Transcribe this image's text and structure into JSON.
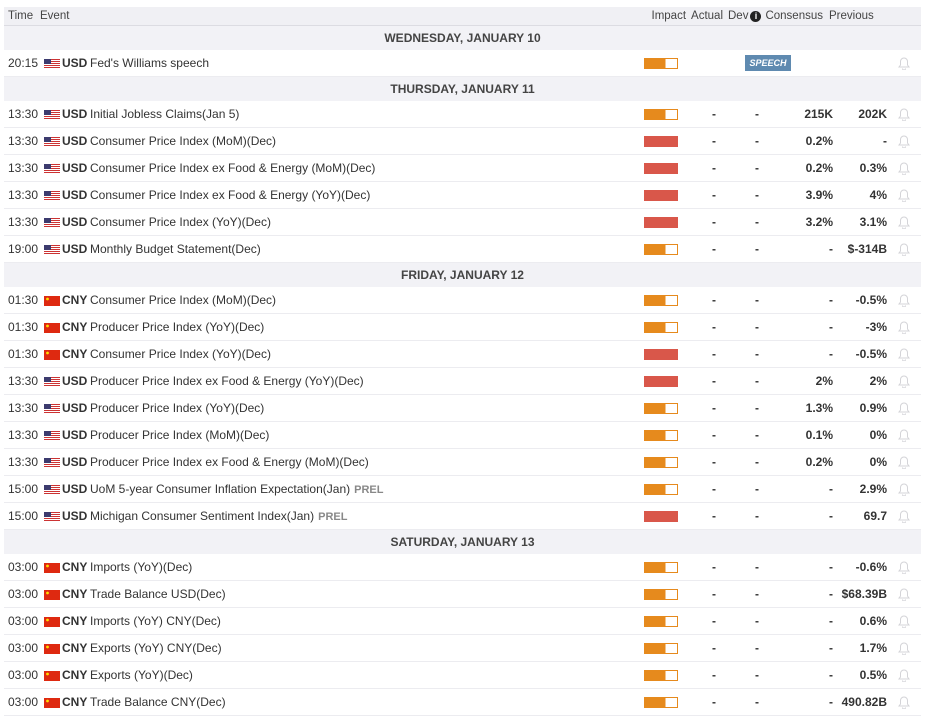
{
  "header": {
    "time": "Time",
    "event": "Event",
    "impact": "Impact",
    "actual": "Actual",
    "dev": "Dev",
    "info_icon": "i",
    "consensus": "Consensus",
    "previous": "Previous"
  },
  "colors": {
    "medium": "#e68a1d",
    "high": "#d9574a",
    "speech": "#5f8ab0"
  },
  "days": [
    {
      "label": "WEDNESDAY, JANUARY 10",
      "events": [
        {
          "time": "20:15",
          "cur": "USD",
          "flag": "us",
          "event": "Fed's Williams speech",
          "impact": "medium",
          "actual": "",
          "dev": "",
          "consensus": "",
          "previous": "",
          "badge": "SPEECH"
        }
      ]
    },
    {
      "label": "THURSDAY, JANUARY 11",
      "events": [
        {
          "time": "13:30",
          "cur": "USD",
          "flag": "us",
          "event": "Initial Jobless Claims(Jan 5)",
          "impact": "medium",
          "actual": "-",
          "dev": "-",
          "consensus": "215K",
          "previous": "202K"
        },
        {
          "time": "13:30",
          "cur": "USD",
          "flag": "us",
          "event": "Consumer Price Index (MoM)(Dec)",
          "impact": "high",
          "actual": "-",
          "dev": "-",
          "consensus": "0.2%",
          "previous": "-"
        },
        {
          "time": "13:30",
          "cur": "USD",
          "flag": "us",
          "event": "Consumer Price Index ex Food & Energy (MoM)(Dec)",
          "impact": "high",
          "actual": "-",
          "dev": "-",
          "consensus": "0.2%",
          "previous": "0.3%"
        },
        {
          "time": "13:30",
          "cur": "USD",
          "flag": "us",
          "event": "Consumer Price Index ex Food & Energy (YoY)(Dec)",
          "impact": "high",
          "actual": "-",
          "dev": "-",
          "consensus": "3.9%",
          "previous": "4%"
        },
        {
          "time": "13:30",
          "cur": "USD",
          "flag": "us",
          "event": "Consumer Price Index (YoY)(Dec)",
          "impact": "high",
          "actual": "-",
          "dev": "-",
          "consensus": "3.2%",
          "previous": "3.1%"
        },
        {
          "time": "19:00",
          "cur": "USD",
          "flag": "us",
          "event": "Monthly Budget Statement(Dec)",
          "impact": "medium",
          "actual": "-",
          "dev": "-",
          "consensus": "-",
          "previous": "$-314B"
        }
      ]
    },
    {
      "label": "FRIDAY, JANUARY 12",
      "events": [
        {
          "time": "01:30",
          "cur": "CNY",
          "flag": "cn",
          "event": "Consumer Price Index (MoM)(Dec)",
          "impact": "medium",
          "actual": "-",
          "dev": "-",
          "consensus": "-",
          "previous": "-0.5%"
        },
        {
          "time": "01:30",
          "cur": "CNY",
          "flag": "cn",
          "event": "Producer Price Index (YoY)(Dec)",
          "impact": "medium",
          "actual": "-",
          "dev": "-",
          "consensus": "-",
          "previous": "-3%"
        },
        {
          "time": "01:30",
          "cur": "CNY",
          "flag": "cn",
          "event": "Consumer Price Index (YoY)(Dec)",
          "impact": "high",
          "actual": "-",
          "dev": "-",
          "consensus": "-",
          "previous": "-0.5%"
        },
        {
          "time": "13:30",
          "cur": "USD",
          "flag": "us",
          "event": "Producer Price Index ex Food & Energy (YoY)(Dec)",
          "impact": "high",
          "actual": "-",
          "dev": "-",
          "consensus": "2%",
          "previous": "2%"
        },
        {
          "time": "13:30",
          "cur": "USD",
          "flag": "us",
          "event": "Producer Price Index (YoY)(Dec)",
          "impact": "medium",
          "actual": "-",
          "dev": "-",
          "consensus": "1.3%",
          "previous": "0.9%"
        },
        {
          "time": "13:30",
          "cur": "USD",
          "flag": "us",
          "event": "Producer Price Index (MoM)(Dec)",
          "impact": "medium",
          "actual": "-",
          "dev": "-",
          "consensus": "0.1%",
          "previous": "0%"
        },
        {
          "time": "13:30",
          "cur": "USD",
          "flag": "us",
          "event": "Producer Price Index ex Food & Energy (MoM)(Dec)",
          "impact": "medium",
          "actual": "-",
          "dev": "-",
          "consensus": "0.2%",
          "previous": "0%"
        },
        {
          "time": "15:00",
          "cur": "USD",
          "flag": "us",
          "event": "UoM 5-year Consumer Inflation Expectation(Jan)",
          "tag": "PREL",
          "impact": "medium",
          "actual": "-",
          "dev": "-",
          "consensus": "-",
          "previous": "2.9%"
        },
        {
          "time": "15:00",
          "cur": "USD",
          "flag": "us",
          "event": "Michigan Consumer Sentiment Index(Jan)",
          "tag": "PREL",
          "impact": "high",
          "actual": "-",
          "dev": "-",
          "consensus": "-",
          "previous": "69.7"
        }
      ]
    },
    {
      "label": "SATURDAY, JANUARY 13",
      "events": [
        {
          "time": "03:00",
          "cur": "CNY",
          "flag": "cn",
          "event": "Imports (YoY)(Dec)",
          "impact": "medium",
          "actual": "-",
          "dev": "-",
          "consensus": "-",
          "previous": "-0.6%"
        },
        {
          "time": "03:00",
          "cur": "CNY",
          "flag": "cn",
          "event": "Trade Balance USD(Dec)",
          "impact": "medium",
          "actual": "-",
          "dev": "-",
          "consensus": "-",
          "previous": "$68.39B"
        },
        {
          "time": "03:00",
          "cur": "CNY",
          "flag": "cn",
          "event": "Imports (YoY) CNY(Dec)",
          "impact": "medium",
          "actual": "-",
          "dev": "-",
          "consensus": "-",
          "previous": "0.6%"
        },
        {
          "time": "03:00",
          "cur": "CNY",
          "flag": "cn",
          "event": "Exports (YoY) CNY(Dec)",
          "impact": "medium",
          "actual": "-",
          "dev": "-",
          "consensus": "-",
          "previous": "1.7%"
        },
        {
          "time": "03:00",
          "cur": "CNY",
          "flag": "cn",
          "event": "Exports (YoY)(Dec)",
          "impact": "medium",
          "actual": "-",
          "dev": "-",
          "consensus": "-",
          "previous": "0.5%"
        },
        {
          "time": "03:00",
          "cur": "CNY",
          "flag": "cn",
          "event": "Trade Balance CNY(Dec)",
          "impact": "medium",
          "actual": "-",
          "dev": "-",
          "consensus": "-",
          "previous": "490.82B"
        }
      ]
    }
  ]
}
